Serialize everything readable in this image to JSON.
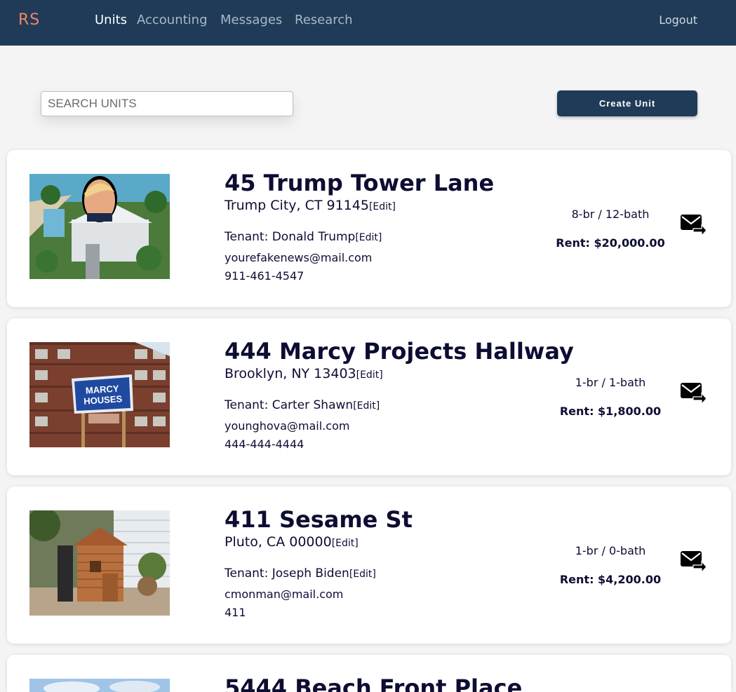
{
  "nav": {
    "logo": "RS",
    "links": [
      "Units",
      "Accounting",
      "Messages",
      "Research"
    ],
    "active": "Units",
    "logout": "Logout"
  },
  "search": {
    "placeholder": "SEARCH UNITS",
    "value": ""
  },
  "create_button": "Create Unit",
  "edit_label": "[Edit]",
  "units": [
    {
      "address": "45 Trump Tower Lane",
      "city": "Trump City, CT 91145",
      "tenant": "Tenant: Donald Trump",
      "email": "yourefakenews@mail.com",
      "phone": "911-461-4547",
      "beds": "8-br / 12-bath",
      "rent": "Rent: $20,000.00"
    },
    {
      "address": "444 Marcy Projects Hallway",
      "city": "Brooklyn, NY 13403",
      "tenant": "Tenant: Carter Shawn",
      "email": "younghova@mail.com",
      "phone": "444-444-4444",
      "beds": "1-br / 1-bath",
      "rent": "Rent: $1,800.00"
    },
    {
      "address": "411 Sesame St",
      "city": "Pluto, CA 00000",
      "tenant": "Tenant: Joseph Biden",
      "email": "cmonman@mail.com",
      "phone": "411",
      "beds": "1-br / 0-bath",
      "rent": "Rent: $4,200.00"
    },
    {
      "address": "5444 Beach Front Place"
    }
  ],
  "photo_labels": {
    "sign_line1": "MARCY",
    "sign_line2": "HOUSES"
  },
  "icons": {
    "message": "mail-send-icon"
  }
}
